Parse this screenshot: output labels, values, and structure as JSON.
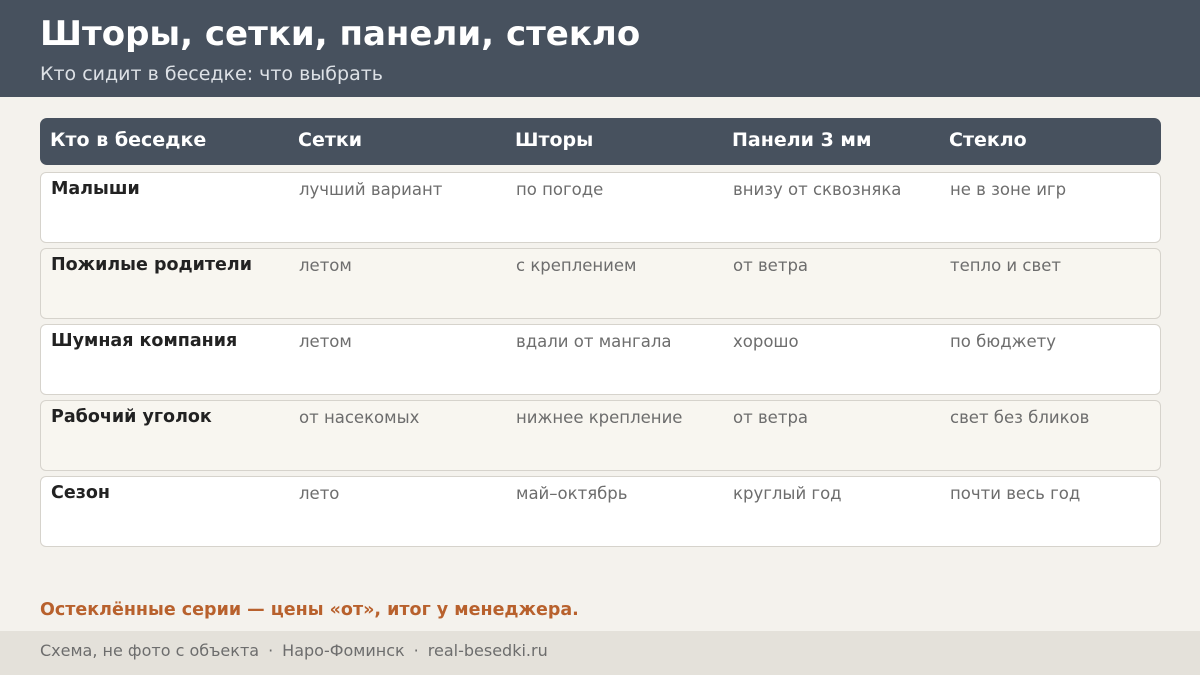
{
  "header": {
    "title": "Шторы, сетки, панели, стекло",
    "subtitle": "Кто сидит в беседке: что выбрать"
  },
  "table": {
    "columns": [
      "Кто в беседке",
      "Сетки",
      "Шторы",
      "Панели 3 мм",
      "Стекло"
    ],
    "rows": [
      [
        "Малыши",
        "лучший вариант",
        "по погоде",
        "внизу от сквозняка",
        "не в зоне игр"
      ],
      [
        "Пожилые родители",
        "летом",
        "с креплением",
        "от ветра",
        "тепло и свет"
      ],
      [
        "Шумная компания",
        "летом",
        "вдали от мангала",
        "хорошо",
        "по бюджету"
      ],
      [
        "Рабочий уголок",
        "от насекомых",
        "нижнее крепление",
        "от ветра",
        "свет без бликов"
      ],
      [
        "Сезон",
        "лето",
        "май–октябрь",
        "круглый год",
        "почти весь год"
      ]
    ]
  },
  "note": "Остеклённые серии — цены «от», итог у менеджера.",
  "footer": {
    "items": [
      "Схема, не фото с объекта",
      "Наро-Фоминск",
      "real-besedki.ru"
    ],
    "separator": "·"
  },
  "colors": {
    "header_bg": "#47515e",
    "accent": "#b8612d",
    "page_bg": "#f4f2ed"
  }
}
